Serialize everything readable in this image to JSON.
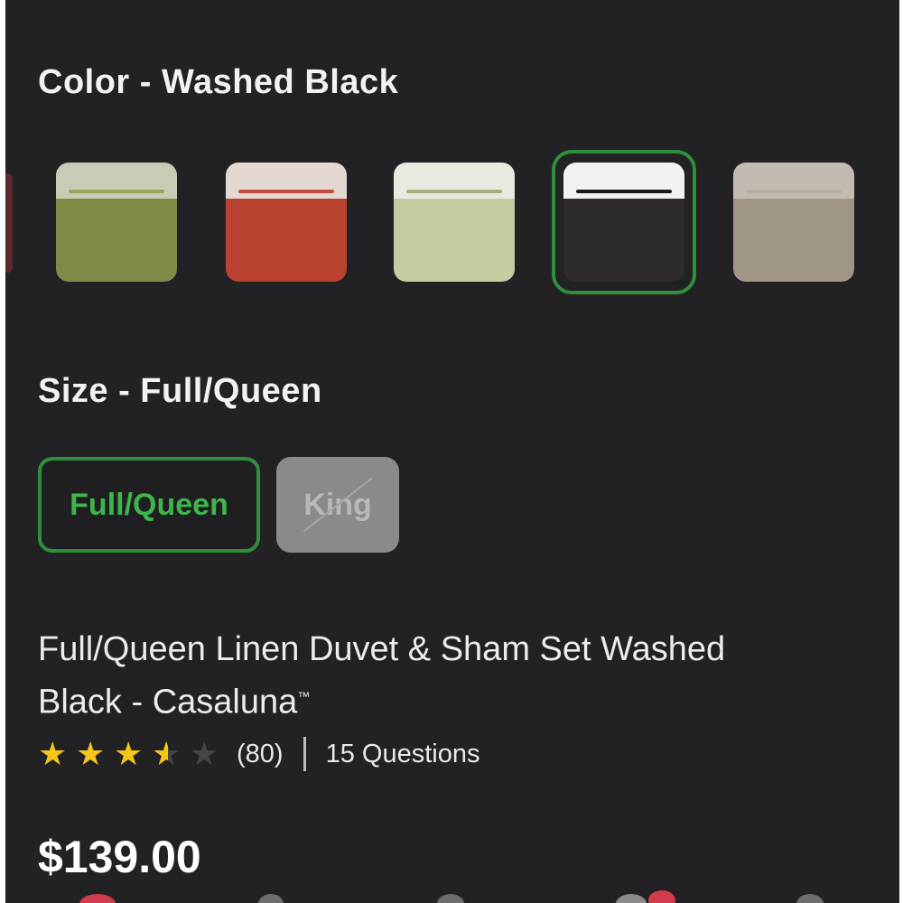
{
  "color_section": {
    "label": "Color - Washed Black",
    "swatches": [
      {
        "name": "green",
        "body": "#7f8a46",
        "top": "#c8ccb4",
        "line": "#9aa35a",
        "selected": false
      },
      {
        "name": "red",
        "body": "#b9412f",
        "top": "#e3d8d2",
        "line": "#c0503d",
        "selected": false
      },
      {
        "name": "sage",
        "body": "#c6cba2",
        "top": "#e9e9e1",
        "line": "#a9ae7e",
        "selected": false
      },
      {
        "name": "washed-black",
        "body": "#2e2a2b",
        "top": "#f1f1f1",
        "line": "#1b1b1b",
        "selected": true
      },
      {
        "name": "taupe",
        "body": "#a09688",
        "top": "#c2bbb2",
        "line": "#b7ae9f",
        "selected": false
      }
    ],
    "selected_color": "#2e8f3a"
  },
  "size_section": {
    "label": "Size - Full/Queen",
    "options": [
      {
        "label": "Full/Queen",
        "state": "selected"
      },
      {
        "label": "King",
        "state": "unavailable"
      }
    ]
  },
  "product": {
    "title_line1": "Full/Queen Linen Duvet & Sham Set Washed",
    "title_line2": "Black - Casaluna",
    "trademark": "™",
    "rating": 3.5,
    "reviews": "(80)",
    "questions": "15 Questions",
    "price": "$139.00"
  }
}
